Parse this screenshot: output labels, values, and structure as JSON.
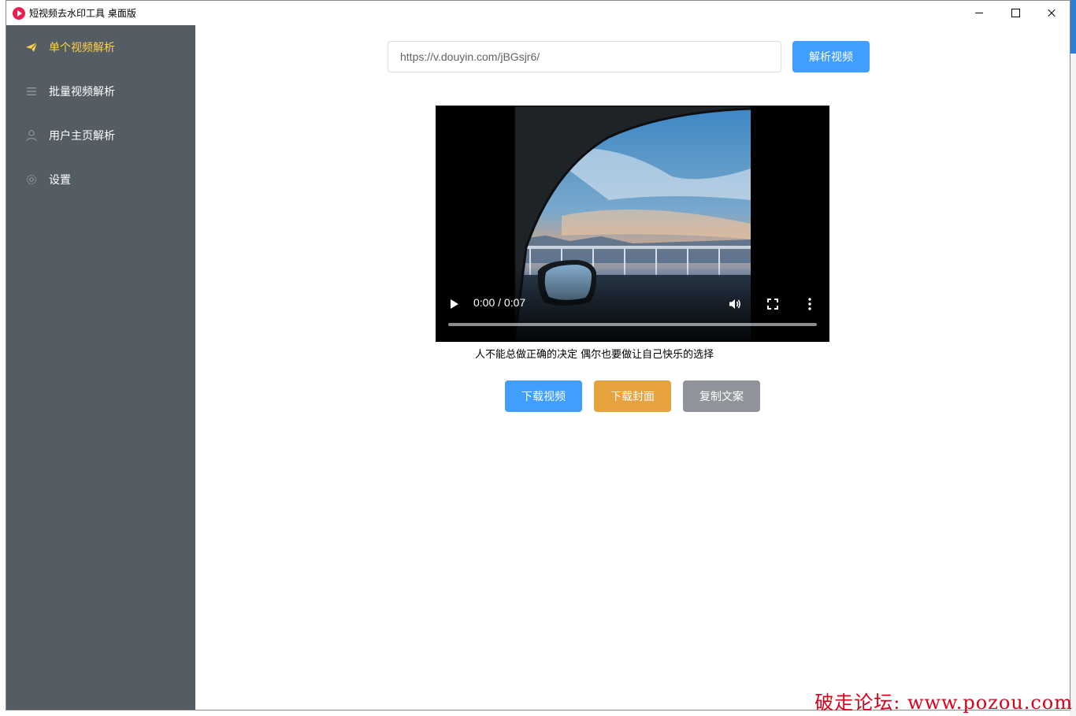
{
  "window": {
    "title": "短视频去水印工具 桌面版",
    "minimize_icon": "minimize-icon",
    "maximize_icon": "maximize-icon",
    "close_icon": "close-icon"
  },
  "sidebar": {
    "background": "#545c64",
    "active_color": "#ffd04b",
    "items": [
      {
        "label": "单个视频解析",
        "icon": "paper-plane-icon",
        "active": true
      },
      {
        "label": "批量视频解析",
        "icon": "list-icon",
        "active": false
      },
      {
        "label": "用户主页解析",
        "icon": "user-icon",
        "active": false
      },
      {
        "label": "设置",
        "icon": "gear-icon",
        "active": false
      }
    ]
  },
  "search": {
    "value": "https://v.douyin.com/jBGsjr6/",
    "button_label": "解析视频"
  },
  "video": {
    "current_time": "0:00",
    "duration": "0:07",
    "time_display": "0:00 / 0:07",
    "progress": 0,
    "caption": "人不能总做正确的决定 偶尔也要做让自己快乐的选择"
  },
  "actions": [
    {
      "label": "下载视频",
      "color": "#409eff"
    },
    {
      "label": "下载封面",
      "color": "#e6a23c"
    },
    {
      "label": "复制文案",
      "color": "#909399"
    }
  ],
  "watermark": "破走论坛: www.pozou.com"
}
